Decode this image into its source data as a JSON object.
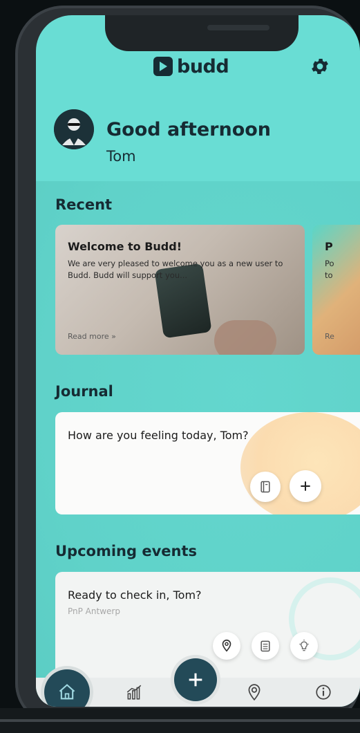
{
  "app": {
    "logo_text": "budd"
  },
  "header": {
    "greeting": "Good afternoon",
    "username": "Tom"
  },
  "recent": {
    "title": "Recent",
    "cards": [
      {
        "title": "Welcome to Budd!",
        "text": "We are very pleased to welcome you as a new user to Budd. Budd will support you...",
        "link": "Read more »"
      },
      {
        "title": "P",
        "text": "Po\nto",
        "link": "Re"
      }
    ]
  },
  "journal": {
    "title": "Journal",
    "prompt": "How are you feeling today, Tom?"
  },
  "events": {
    "title": "Upcoming events",
    "card_title": "Ready to check in, Tom?",
    "card_subtitle": "PnP Antwerp"
  },
  "nav": {
    "items": [
      "home-icon",
      "stats-icon",
      "add-icon",
      "location-icon",
      "info-icon"
    ]
  },
  "colors": {
    "background": "#69ddd4",
    "primary": "#234a58",
    "text": "#162b33"
  }
}
